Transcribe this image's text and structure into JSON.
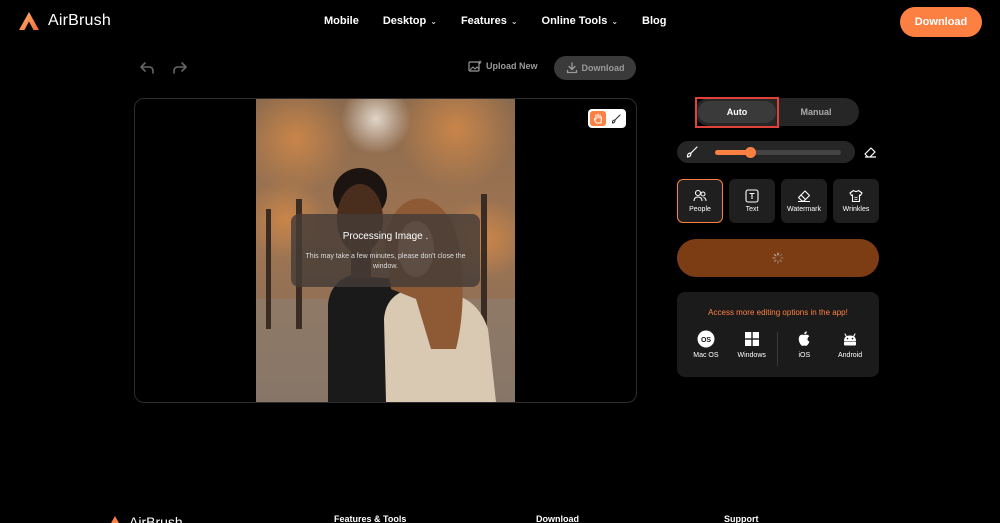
{
  "header": {
    "logo_text": "AirBrush",
    "nav": [
      {
        "label": "Mobile",
        "has_dropdown": false
      },
      {
        "label": "Desktop",
        "has_dropdown": true
      },
      {
        "label": "Features",
        "has_dropdown": true
      },
      {
        "label": "Online Tools",
        "has_dropdown": true
      },
      {
        "label": "Blog",
        "has_dropdown": false
      }
    ],
    "download_label": "Download"
  },
  "toolbar": {
    "upload_new_label": "Upload New",
    "download_label": "Download"
  },
  "canvas": {
    "processing_title": "Processing Image .",
    "processing_desc": "This may take a few minutes, please don't close the window."
  },
  "panel": {
    "modes": {
      "auto": "Auto",
      "manual": "Manual",
      "selected": "Auto"
    },
    "brush_size_percent": 28,
    "tools": [
      {
        "label": "People",
        "icon": "people-icon",
        "active": true
      },
      {
        "label": "Text",
        "icon": "text-icon",
        "active": false
      },
      {
        "label": "Watermark",
        "icon": "eraser-icon",
        "active": false
      },
      {
        "label": "Wrinkles",
        "icon": "shirt-icon",
        "active": false
      }
    ],
    "promo_title": "Access more editing options in the app!",
    "platforms": [
      {
        "label": "Mac OS",
        "icon": "macos-icon"
      },
      {
        "label": "Windows",
        "icon": "windows-icon"
      },
      {
        "label": "iOS",
        "icon": "apple-icon"
      },
      {
        "label": "Android",
        "icon": "android-icon"
      }
    ]
  },
  "footer": {
    "logo_text": "AirBrush",
    "columns": [
      "Features & Tools",
      "Download",
      "Support"
    ]
  },
  "colors": {
    "accent": "#fd8043",
    "remove_button": "#7c3d15",
    "highlight_box": "#e0413a"
  }
}
